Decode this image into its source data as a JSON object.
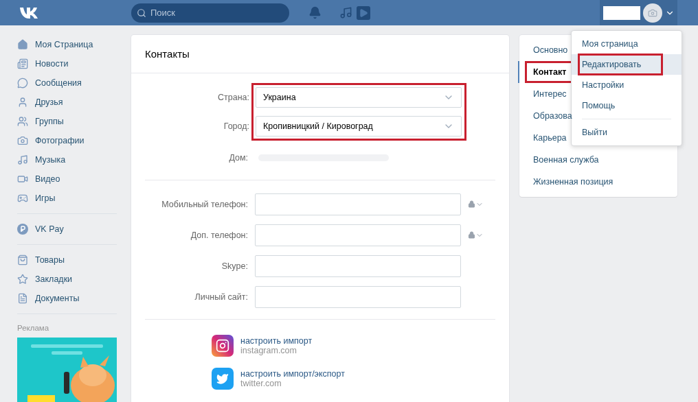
{
  "header": {
    "search_placeholder": "Поиск"
  },
  "sidebar": {
    "groups": [
      [
        {
          "label": "Моя Страница"
        },
        {
          "label": "Новости"
        },
        {
          "label": "Сообщения"
        },
        {
          "label": "Друзья"
        },
        {
          "label": "Группы"
        },
        {
          "label": "Фотографии"
        },
        {
          "label": "Музыка"
        },
        {
          "label": "Видео"
        },
        {
          "label": "Игры"
        }
      ],
      [
        {
          "label": "VK Pay"
        }
      ],
      [
        {
          "label": "Товары"
        },
        {
          "label": "Закладки"
        },
        {
          "label": "Документы"
        }
      ]
    ],
    "ad_label": "Реклама",
    "ad": {
      "kind": "picture"
    }
  },
  "main": {
    "title": "Контакты",
    "location": {
      "highlighted": true,
      "fields": [
        {
          "label": "Страна:",
          "value": "Украина"
        },
        {
          "label": "Город:",
          "value": "Кропивницкий / Кировоград"
        }
      ]
    },
    "home_label": "Дом:",
    "phones": [
      {
        "label": "Мобильный телефон:",
        "kind": "private"
      },
      {
        "label": "Доп. телефон:",
        "kind": "private"
      },
      {
        "label": "Skype:",
        "kind": "plain"
      },
      {
        "label": "Личный сайт:",
        "kind": "plain"
      }
    ],
    "imports": [
      {
        "kind": "instagram",
        "action": "настроить импорт",
        "site": "instagram.com"
      },
      {
        "kind": "twitter",
        "action": "настроить импорт/экспорт",
        "site": "twitter.com"
      }
    ]
  },
  "settings_menu": [
    {
      "label": "Основно",
      "selected": false,
      "highlighted": false
    },
    {
      "label": "Контакт",
      "selected": true,
      "highlighted": true
    },
    {
      "label": "Интерес",
      "selected": false,
      "highlighted": false
    },
    {
      "label": "Образова",
      "selected": false,
      "highlighted": false
    },
    {
      "label": "Карьера",
      "selected": false,
      "highlighted": false
    },
    {
      "label": "Военная служба",
      "selected": false,
      "highlighted": false
    },
    {
      "label": "Жизненная позиция",
      "selected": false,
      "highlighted": false
    }
  ],
  "dropdown": [
    [
      {
        "label": "Моя страница",
        "selected": false,
        "highlighted": false
      },
      {
        "label": "Редактировать",
        "selected": true,
        "highlighted": true
      },
      {
        "label": "Настройки",
        "selected": false,
        "highlighted": false
      },
      {
        "label": "Помощь",
        "selected": false,
        "highlighted": false
      }
    ],
    [
      {
        "label": "Выйти",
        "selected": false,
        "highlighted": false
      }
    ]
  ]
}
